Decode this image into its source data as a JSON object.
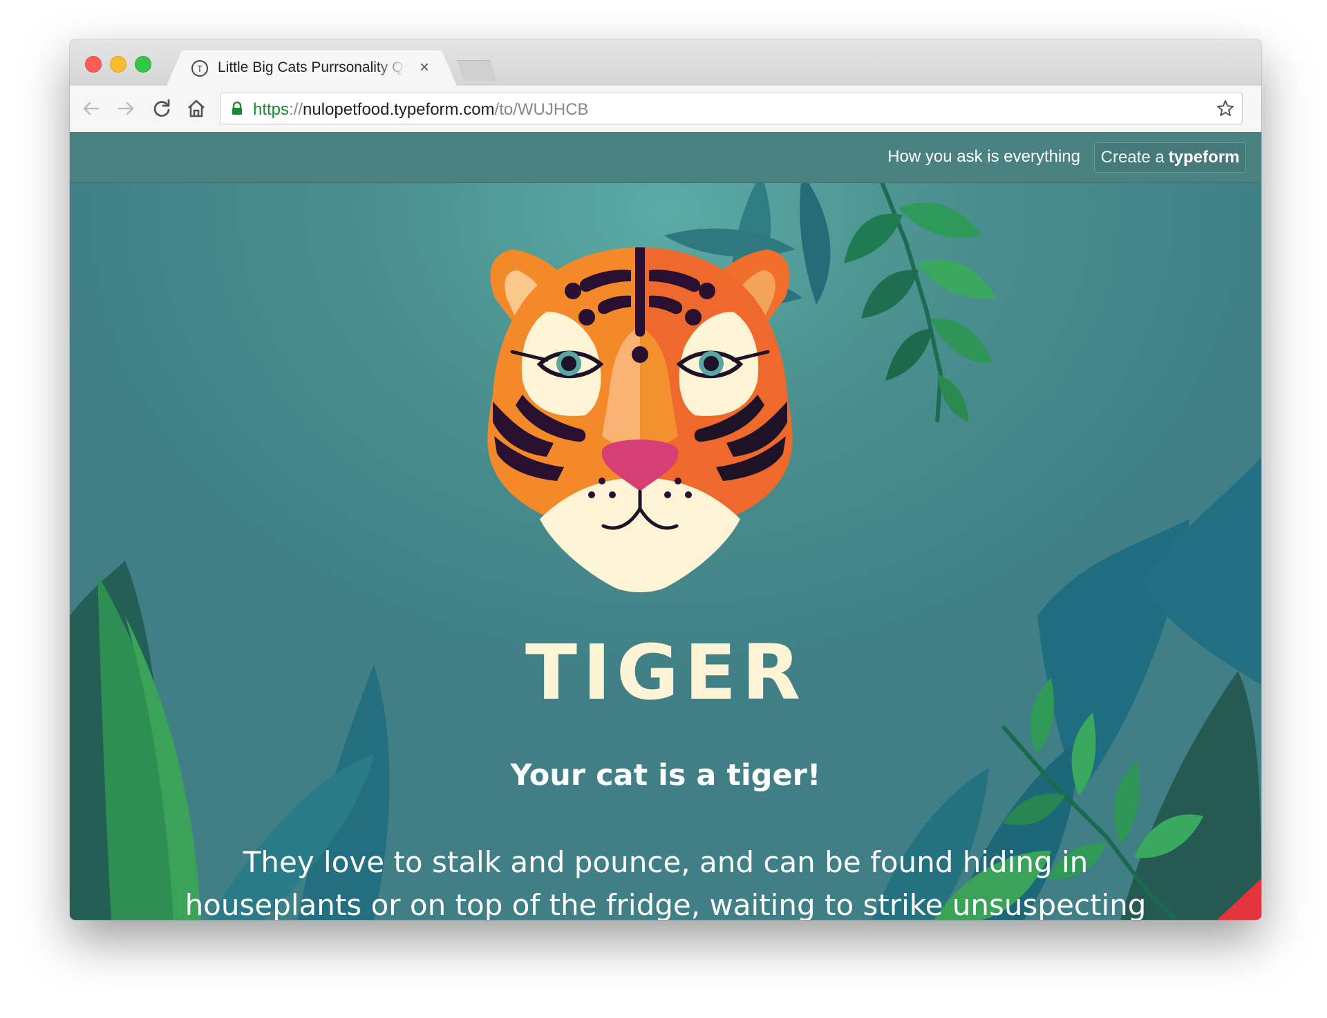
{
  "browser": {
    "tab": {
      "favicon_letter": "T",
      "title": "Little Big Cats Purrsonality Quiz",
      "close_label": "×"
    },
    "address": {
      "protocol": "https",
      "separator": "://",
      "host": "nulopetfood.typeform.com",
      "path": "/to/WUJHCB"
    },
    "colors": {
      "secure_green": "#198a2f"
    }
  },
  "page": {
    "header": {
      "tagline": "How you ask is everything",
      "cta_prefix": "Create a",
      "cta_brand": "typeform"
    },
    "result": {
      "title": "TIGER",
      "subtitle": "Your cat is a tiger!",
      "description": "They love to stalk and pounce, and can be found hiding in houseplants or on top of the fridge, waiting to strike unsuspecting toys. Tigers are"
    },
    "colors": {
      "background": "#4a908f",
      "header_bar": "#4a8281",
      "title_text": "#fdf3d5",
      "tiger_orange": "#f4892a",
      "tiger_nose": "#d53f73"
    }
  }
}
